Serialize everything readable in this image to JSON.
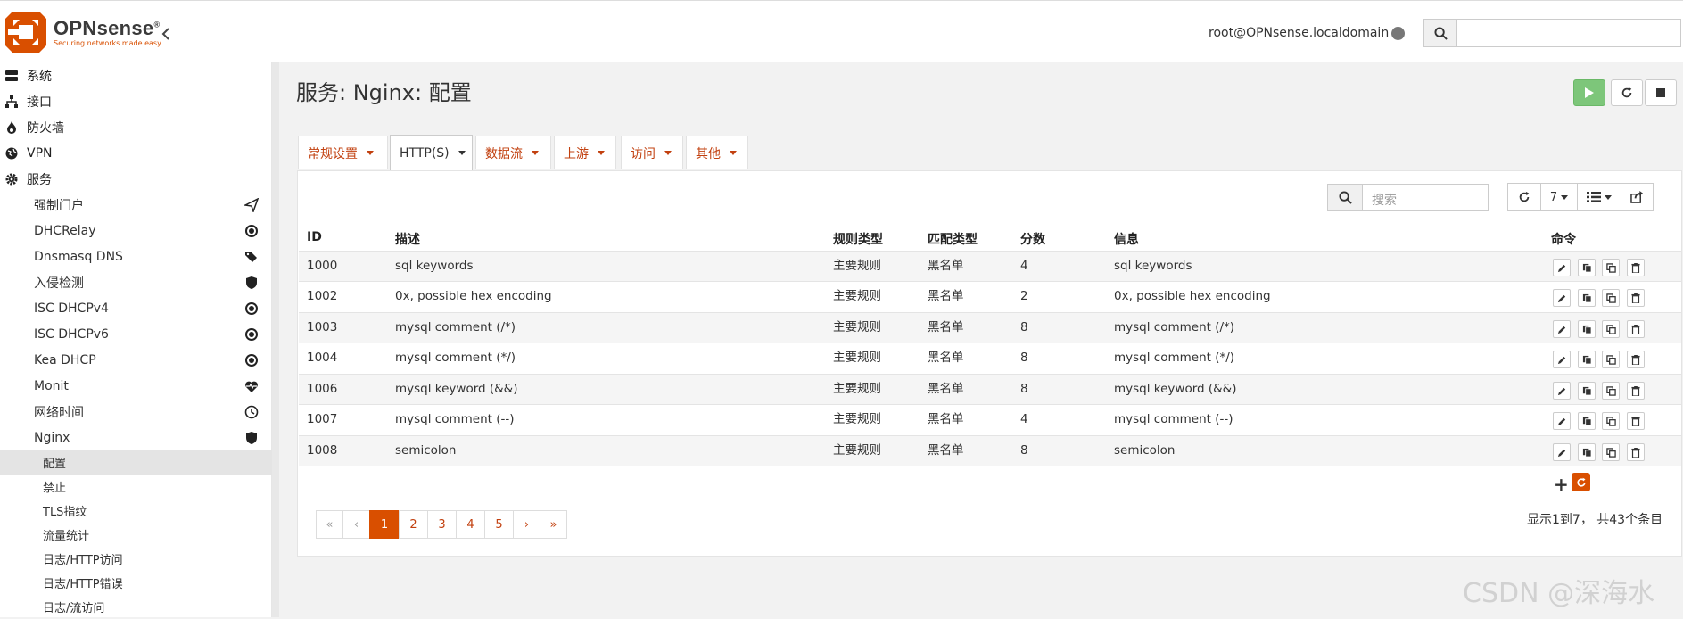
{
  "header": {
    "brand": "OPNsense",
    "tagline": "Securing networks made easy",
    "user": "root@OPNsense.localdomain"
  },
  "sidebar": {
    "top_items": [
      {
        "label": "系统",
        "icon": "server-icon"
      },
      {
        "label": "接口",
        "icon": "sitemap-icon"
      },
      {
        "label": "防火墙",
        "icon": "fire-icon"
      },
      {
        "label": "VPN",
        "icon": "globe-icon"
      },
      {
        "label": "服务",
        "icon": "cog-icon"
      }
    ],
    "services": [
      {
        "label": "强制门户",
        "icon": "send-icon"
      },
      {
        "label": "DHCRelay",
        "icon": "bullseye-icon"
      },
      {
        "label": "Dnsmasq DNS",
        "icon": "tags-icon"
      },
      {
        "label": "入侵检测",
        "icon": "shield-icon"
      },
      {
        "label": "ISC DHCPv4",
        "icon": "bullseye-icon"
      },
      {
        "label": "ISC DHCPv6",
        "icon": "bullseye-icon"
      },
      {
        "label": "Kea DHCP",
        "icon": "bullseye-icon"
      },
      {
        "label": "Monit",
        "icon": "heartbeat-icon"
      },
      {
        "label": "网络时间",
        "icon": "clock-icon"
      },
      {
        "label": "Nginx",
        "icon": "shield-icon"
      }
    ],
    "nginx_items": [
      "配置",
      "禁止",
      "TLS指纹",
      "流量统计",
      "日志/HTTP访问",
      "日志/HTTP错误",
      "日志/流访问"
    ]
  },
  "page": {
    "title": "服务: Nginx: 配置"
  },
  "tabs": [
    "常规设置",
    "HTTP(S)",
    "数据流",
    "上游",
    "访问",
    "其他"
  ],
  "grid": {
    "search_placeholder": "搜索",
    "page_size": "7",
    "columns": [
      "ID",
      "描述",
      "规则类型",
      "匹配类型",
      "分数",
      "信息",
      "命令"
    ],
    "rows": [
      {
        "id": "1000",
        "desc": "sql keywords",
        "rule_type": "主要规则",
        "match_type": "黑名单",
        "score": "4",
        "info": "sql keywords"
      },
      {
        "id": "1002",
        "desc": "0x, possible hex encoding",
        "rule_type": "主要规则",
        "match_type": "黑名单",
        "score": "2",
        "info": "0x, possible hex encoding"
      },
      {
        "id": "1003",
        "desc": "mysql comment (/*)",
        "rule_type": "主要规则",
        "match_type": "黑名单",
        "score": "8",
        "info": "mysql comment (/*)"
      },
      {
        "id": "1004",
        "desc": "mysql comment (*/)",
        "rule_type": "主要规则",
        "match_type": "黑名单",
        "score": "8",
        "info": "mysql comment (*/)"
      },
      {
        "id": "1006",
        "desc": "mysql keyword (&&)",
        "rule_type": "主要规则",
        "match_type": "黑名单",
        "score": "8",
        "info": "mysql keyword (&&)"
      },
      {
        "id": "1007",
        "desc": "mysql comment (--)",
        "rule_type": "主要规则",
        "match_type": "黑名单",
        "score": "4",
        "info": "mysql comment (--)"
      },
      {
        "id": "1008",
        "desc": "semicolon",
        "rule_type": "主要规则",
        "match_type": "黑名单",
        "score": "8",
        "info": "semicolon"
      }
    ],
    "add_symbol": "+",
    "pagination": [
      "«",
      "‹",
      "1",
      "2",
      "3",
      "4",
      "5",
      "›",
      "»"
    ],
    "info_text": "显示1到7， 共43个条目"
  },
  "watermark": "CSDN @深海水",
  "colors": {
    "accent": "#d94f00",
    "play": "#7dc67a"
  }
}
